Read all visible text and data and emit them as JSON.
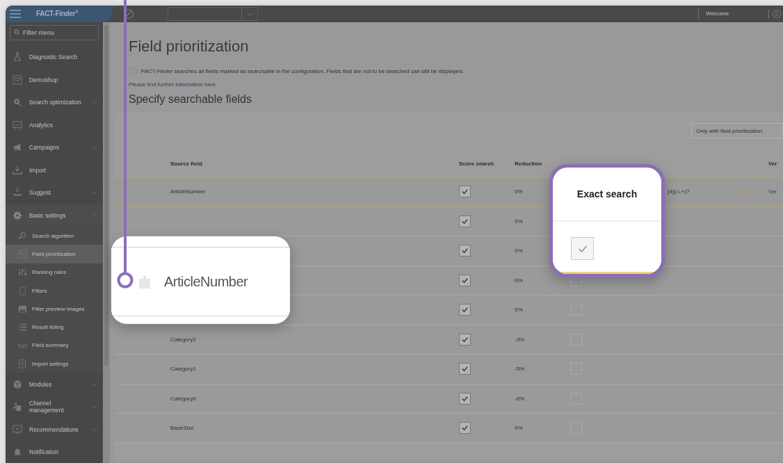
{
  "top_bar": {
    "logo": "FACT-Finder$^{®}$",
    "welcome": "Welcome"
  },
  "sidebar": {
    "filter_placeholder": "Filter menu",
    "items": [
      {
        "label": "Diagnostic Search",
        "selected": false
      },
      {
        "label": "Demoshop",
        "selected": false
      },
      {
        "label": "Search optimization",
        "expanded": false,
        "selected": false
      },
      {
        "label": "Analytics",
        "selected": false
      },
      {
        "label": "Campaigns",
        "expanded": false,
        "selected": false
      },
      {
        "label": "Import",
        "selected": false
      },
      {
        "label": "Suggest",
        "expanded": false,
        "selected": false
      },
      {
        "label": "Basic settings",
        "expanded": true,
        "selected": false,
        "children": [
          {
            "label": "Search algorithm",
            "selected": false
          },
          {
            "label": "Field prioritization",
            "selected": true
          },
          {
            "label": "Ranking rules",
            "selected": false
          },
          {
            "label": "Filters",
            "selected": false
          },
          {
            "label": "Filter preview images",
            "selected": false
          },
          {
            "label": "Result listing",
            "selected": false
          },
          {
            "label": "Field summary",
            "selected": false
          },
          {
            "label": "Import settings",
            "selected": false
          }
        ]
      },
      {
        "label": "Modules",
        "expanded": false,
        "selected": false
      },
      {
        "label": "Channel management",
        "expanded": false,
        "selected": false
      },
      {
        "label": "Recommendations",
        "expanded": false,
        "selected": false
      },
      {
        "label": "Notification",
        "selected": false
      }
    ]
  },
  "page": {
    "title": "Field prioritization",
    "info": "FACT-Finder searches all fields marked as searchable in the configuration. Fields that are not to be searched can still be displayed.",
    "link": "Please find further information here.",
    "subtitle": "Specify searchable fields"
  },
  "filter_select": {
    "value": "Only with field prioritization"
  },
  "table": {
    "columns": [
      {
        "label": "Source field"
      },
      {
        "label": "Score search"
      },
      {
        "label": "Reduction"
      },
      {
        "label": "Ver"
      }
    ],
    "rows": [
      {
        "source": "ArticleNumber",
        "score_search": true,
        "reduction": "0%",
        "pattern": "(4)(-\\.+)?",
        "warning": true,
        "link": "Ver"
      },
      {
        "score_search": true,
        "reduction": "0%"
      },
      {
        "score_search": true,
        "reduction": "0%"
      },
      {
        "score_search": true,
        "reduction": "0%",
        "exact_search": false
      },
      {
        "score_search": true,
        "reduction": "0%",
        "exact_search": false
      },
      {
        "source": "Category2",
        "score_search": true,
        "reduction": "-3%",
        "exact_search": false
      },
      {
        "source": "Category1",
        "score_search": true,
        "reduction": "-5%",
        "exact_search": false
      },
      {
        "source": "Category0",
        "score_search": true,
        "reduction": "-6%",
        "exact_search": false
      },
      {
        "source": "BaseSize",
        "score_search": true,
        "reduction": "0%",
        "exact_search": false
      }
    ]
  },
  "callouts": [
    {
      "kind": "cell",
      "text": "ArticleNumber"
    },
    {
      "kind": "column",
      "heading": "Exact search",
      "checked": true
    }
  ]
}
